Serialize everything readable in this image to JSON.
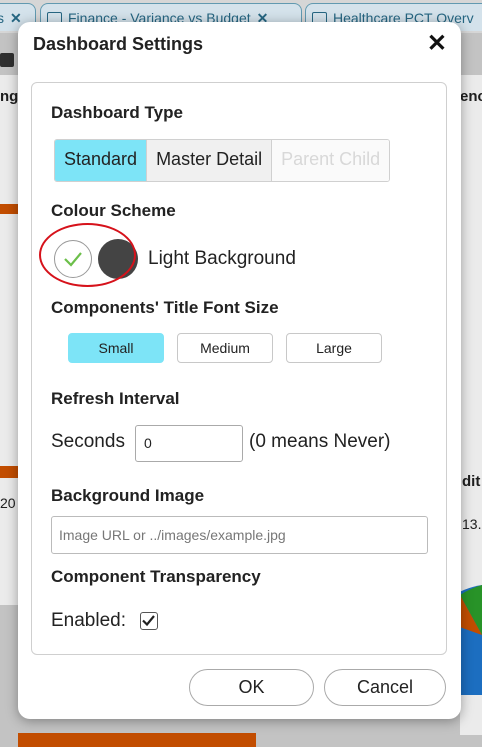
{
  "tabs": [
    {
      "label": "s"
    },
    {
      "label": "Finance - Variance vs Budget"
    },
    {
      "label": "Healthcare PCT Overv"
    }
  ],
  "background": {
    "text_left_top": "ng",
    "text_right_top": "enc",
    "text_left_mid": "20",
    "text_right_mid": "dit",
    "text_right_mid2": "13."
  },
  "dialog": {
    "title": "Dashboard Settings",
    "dashboard_type": {
      "label": "Dashboard Type",
      "options": [
        "Standard",
        "Master Detail",
        "Parent Child"
      ],
      "selected": "Standard",
      "disabled": [
        "Parent Child"
      ]
    },
    "colour_scheme": {
      "label": "Colour Scheme",
      "selected_label": "Light Background",
      "options": [
        "light",
        "dark"
      ],
      "selected": "light"
    },
    "font_size": {
      "label": "Components' Title Font Size",
      "options": [
        "Small",
        "Medium",
        "Large"
      ],
      "selected": "Small"
    },
    "refresh": {
      "label": "Refresh Interval",
      "seconds_label": "Seconds",
      "value": "0",
      "note": "(0 means Never)"
    },
    "background_image": {
      "label": "Background Image",
      "placeholder": "Image URL or ../images/example.jpg"
    },
    "transparency": {
      "label": "Component Transparency",
      "enabled_label": "Enabled:",
      "checked": true
    },
    "ok_label": "OK",
    "cancel_label": "Cancel"
  },
  "colors": {
    "accent_selected": "#7de4f7",
    "highlight_ring": "#d6121b",
    "check_green": "#6cbf4a",
    "dark_swatch": "#444444"
  }
}
